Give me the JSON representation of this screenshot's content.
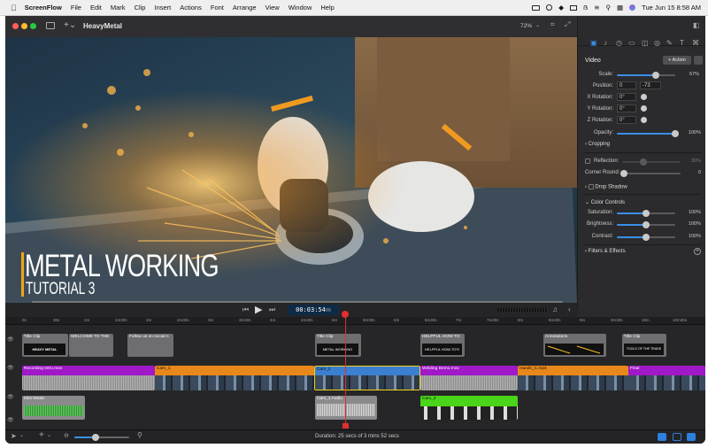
{
  "menubar": {
    "apple": "",
    "app": "ScreenFlow",
    "items": [
      "File",
      "Edit",
      "Mark",
      "Clip",
      "Insert",
      "Actions",
      "Font",
      "Arrange",
      "View",
      "Window",
      "Help"
    ],
    "clock": "Tue Jun 15  8:58 AM"
  },
  "window": {
    "title": "HeavyMetal",
    "zoom": "72%"
  },
  "canvas": {
    "title_line1": "METAL WORKING",
    "title_line2": "TUTORIAL 3",
    "accent": "#f2a516"
  },
  "inspector": {
    "section": "Video",
    "action_button": "+ Action",
    "scale": {
      "label": "Scale:",
      "value": "67%",
      "level": 0.67
    },
    "position": {
      "label": "Position:",
      "x": "0",
      "y": "-73"
    },
    "x_rotation": {
      "label": "X Rotation:",
      "value": "0°"
    },
    "y_rotation": {
      "label": "Y Rotation:",
      "value": "0°"
    },
    "z_rotation": {
      "label": "Z Rotation:",
      "value": "0°"
    },
    "opacity": {
      "label": "Opacity:",
      "value": "100%",
      "level": 1.0
    },
    "cropping": "Cropping",
    "reflection": {
      "label": "Reflection:",
      "value": "30%"
    },
    "corner_round": {
      "label": "Corner Round:",
      "value": "0"
    },
    "drop_shadow": "Drop Shadow",
    "color_controls": "Color Controls",
    "saturation": {
      "label": "Saturation:",
      "value": "100%",
      "level": 0.5
    },
    "brightness": {
      "label": "Brightness:",
      "value": "100%",
      "level": 0.5
    },
    "contrast": {
      "label": "Contrast:",
      "value": "100%",
      "level": 0.5
    },
    "filters": "Filters & Effects"
  },
  "transport": {
    "timecode": "00:03:54",
    "frames": "09"
  },
  "ruler": [
    "0s",
    "30s",
    "1m",
    "1m30s",
    "2m",
    "2m30s",
    "3m",
    "3m30s",
    "4m",
    "4m30s",
    "5m",
    "5m30s",
    "6m",
    "6m30s",
    "7m",
    "7m30s",
    "8m",
    "8m30s",
    "9m",
    "9m30s",
    "10m",
    "10m30s"
  ],
  "tracks": {
    "row1": [
      {
        "label": "Title Clip",
        "thumb": "HEAVY METAL"
      },
      {
        "label": "WELCOME TO THE"
      },
      {
        "label": "Follow us on social n"
      },
      {
        "label": "Title Clip",
        "thumb": "METAL WORKING"
      },
      {
        "label": "HELPFUL  HOW-TO",
        "thumb": "HELPFUL HOW-TO'S"
      },
      {
        "label": "Annotations"
      },
      {
        "label": "Title Clip",
        "thumb": "TOOLS OF THE TRADE"
      }
    ],
    "row2": [
      {
        "label": "Recording Intro.mov",
        "color": "#a018c8"
      },
      {
        "label": "Cam_1",
        "color": "#e8881a"
      },
      {
        "label": "Cam_2",
        "color": "#3b7fd0"
      },
      {
        "label": "Welding Demo.mov",
        "color": "#a018c8"
      },
      {
        "label": "Hands_C.mp4",
        "color": "#e8881a"
      },
      {
        "label": "Final",
        "color": "#a018c8"
      }
    ],
    "row3": [
      {
        "label": "Intro Music"
      },
      {
        "label": "Cam_1 Audio"
      },
      {
        "label": "Cam_3"
      }
    ]
  },
  "footer": {
    "duration": "Duration: 25 secs of 3 mins 52 secs"
  }
}
